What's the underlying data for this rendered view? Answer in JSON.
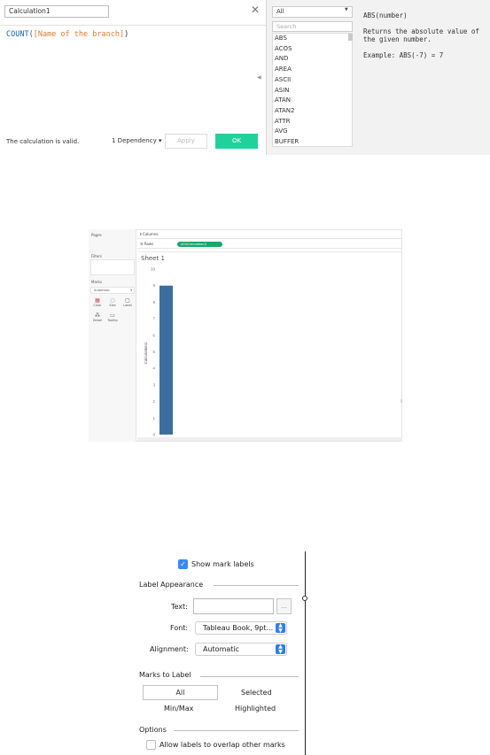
{
  "calc_editor": {
    "name": "Calculation1",
    "close_glyph": "✕",
    "formula_fn": "COUNT(",
    "formula_field": "[Name of the branch]",
    "formula_close": ")",
    "status": "The calculation is valid.",
    "dependency": "1 Dependency ▾",
    "apply_label": "Apply",
    "ok_label": "OK",
    "collapse_glyph": "◀"
  },
  "function_panel": {
    "category": "All",
    "search_placeholder": "Search",
    "functions": [
      "ABS",
      "ACOS",
      "AND",
      "AREA",
      "ASCII",
      "ASIN",
      "ATAN",
      "ATAN2",
      "ATTR",
      "AVG",
      "BUFFER"
    ],
    "signature": "ABS(number)",
    "description": "Returns the absolute value of the given number.",
    "example": "Example: ABS(-7) = 7"
  },
  "worksheet": {
    "pages_label": "Pages",
    "filters_label": "Filters",
    "marks_label": "Marks",
    "marks_type": "Automatic",
    "mark_cards": [
      "Color",
      "Size",
      "Label",
      "Detail",
      "Tooltip"
    ],
    "columns_label": "Columns",
    "rows_label": "Rows",
    "rows_pill": "AGG(Calculation1)",
    "sheet_title": "Sheet 1"
  },
  "chart_data": {
    "type": "bar",
    "categories": [
      ""
    ],
    "values": [
      9
    ],
    "ylabel": "Calculation1",
    "ylim": [
      0,
      10
    ],
    "yticks": [
      0,
      1,
      2,
      3,
      4,
      5,
      6,
      7,
      8,
      9,
      10
    ],
    "bar_color": "#3b6e9e"
  },
  "label_panel": {
    "show_mark_labels": "Show mark labels",
    "label_appearance": "Label Appearance",
    "text_label": "Text:",
    "more_button": "...",
    "font_label": "Font:",
    "font_value": "Tableau Book, 9pt...",
    "alignment_label": "Alignment:",
    "alignment_value": "Automatic",
    "marks_to_label": "Marks to Label",
    "all": "All",
    "selected": "Selected",
    "minmax": "Min/Max",
    "highlighted": "Highlighted",
    "options": "Options",
    "allow_overlap": "Allow labels to overlap other marks"
  }
}
